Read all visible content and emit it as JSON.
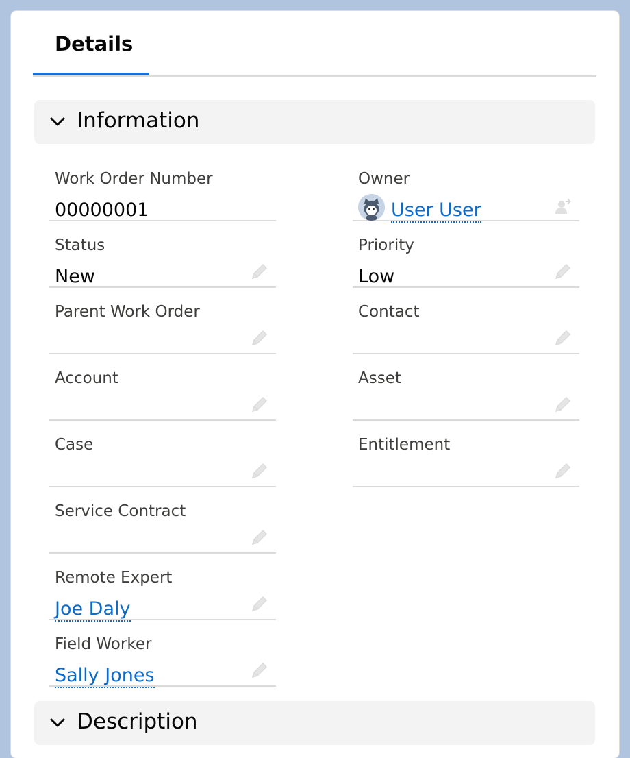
{
  "tabs": [
    {
      "label": "Details"
    }
  ],
  "sections": {
    "information": {
      "title": "Information"
    },
    "description": {
      "title": "Description"
    }
  },
  "fields": {
    "work_order_number": {
      "label": "Work Order Number",
      "value": "00000001"
    },
    "owner": {
      "label": "Owner",
      "value": "User User"
    },
    "status": {
      "label": "Status",
      "value": "New"
    },
    "priority": {
      "label": "Priority",
      "value": "Low"
    },
    "parent_work_order": {
      "label": "Parent Work Order",
      "value": ""
    },
    "contact": {
      "label": "Contact",
      "value": ""
    },
    "account": {
      "label": "Account",
      "value": ""
    },
    "asset": {
      "label": "Asset",
      "value": ""
    },
    "case": {
      "label": "Case",
      "value": ""
    },
    "entitlement": {
      "label": "Entitlement",
      "value": ""
    },
    "service_contract": {
      "label": "Service Contract",
      "value": ""
    },
    "remote_expert": {
      "label": "Remote Expert",
      "value": "Joe Daly"
    },
    "field_worker": {
      "label": "Field Worker",
      "value": "Sally Jones"
    }
  },
  "icons": {
    "edit": "pencil-icon",
    "section_toggle": "chevron-down-icon",
    "owner_avatar": "avatar",
    "change_owner": "change-owner-icon"
  },
  "colors": {
    "accent": "#1b6fd0",
    "link": "#0b6bcb",
    "section_bg": "#f3f3f3",
    "page_bg": "#b0c4df"
  }
}
